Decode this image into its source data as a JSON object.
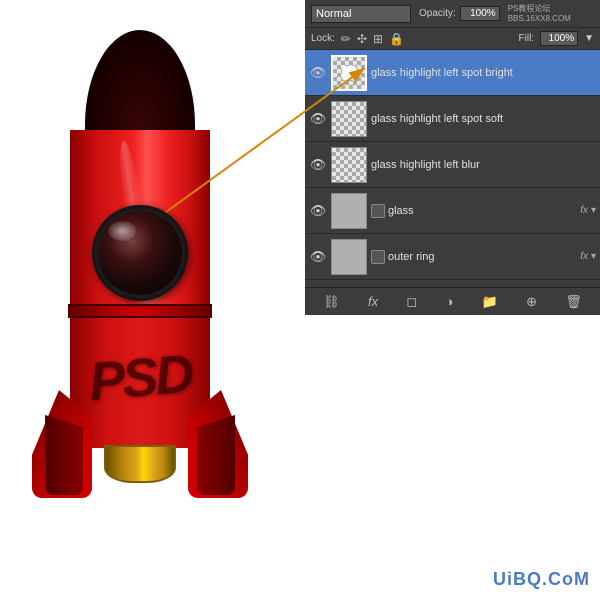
{
  "panel": {
    "blend_mode": "Normal",
    "opacity_label": "Opacity:",
    "opacity_value": "100%",
    "lock_label": "Lock:",
    "fill_label": "Fill:",
    "fill_value": "100%",
    "watermark_top": "PS教程论坛\nBBS.16XX8.COM",
    "layers": [
      {
        "id": "layer1",
        "name": "glass highlight left spot bright",
        "selected": true,
        "has_eye": true,
        "has_link": false,
        "thumb_type": "checkered-selected",
        "fx": false
      },
      {
        "id": "layer2",
        "name": "glass highlight left spot soft",
        "selected": false,
        "has_eye": true,
        "has_link": false,
        "thumb_type": "checkered",
        "fx": false
      },
      {
        "id": "layer3",
        "name": "glass highlight left blur",
        "selected": false,
        "has_eye": true,
        "has_link": false,
        "thumb_type": "checkered",
        "fx": false
      },
      {
        "id": "layer4",
        "name": "glass",
        "selected": false,
        "has_eye": true,
        "has_link": true,
        "thumb_type": "gray",
        "fx": true
      },
      {
        "id": "layer5",
        "name": "outer ring",
        "selected": false,
        "has_eye": true,
        "has_link": true,
        "thumb_type": "gray",
        "fx": true
      }
    ],
    "toolbar": {
      "link_btn": "⛓",
      "fx_btn": "fx",
      "mask_btn": "◉",
      "folder_btn": "📁",
      "adjust_btn": "⊕",
      "delete_btn": "🗑"
    }
  },
  "watermark": {
    "text": "UiBQ.CoM"
  },
  "rocket": {
    "psd_text": "PSD"
  },
  "arrows": {
    "arrow1_label": "",
    "arrow2_label": ""
  }
}
